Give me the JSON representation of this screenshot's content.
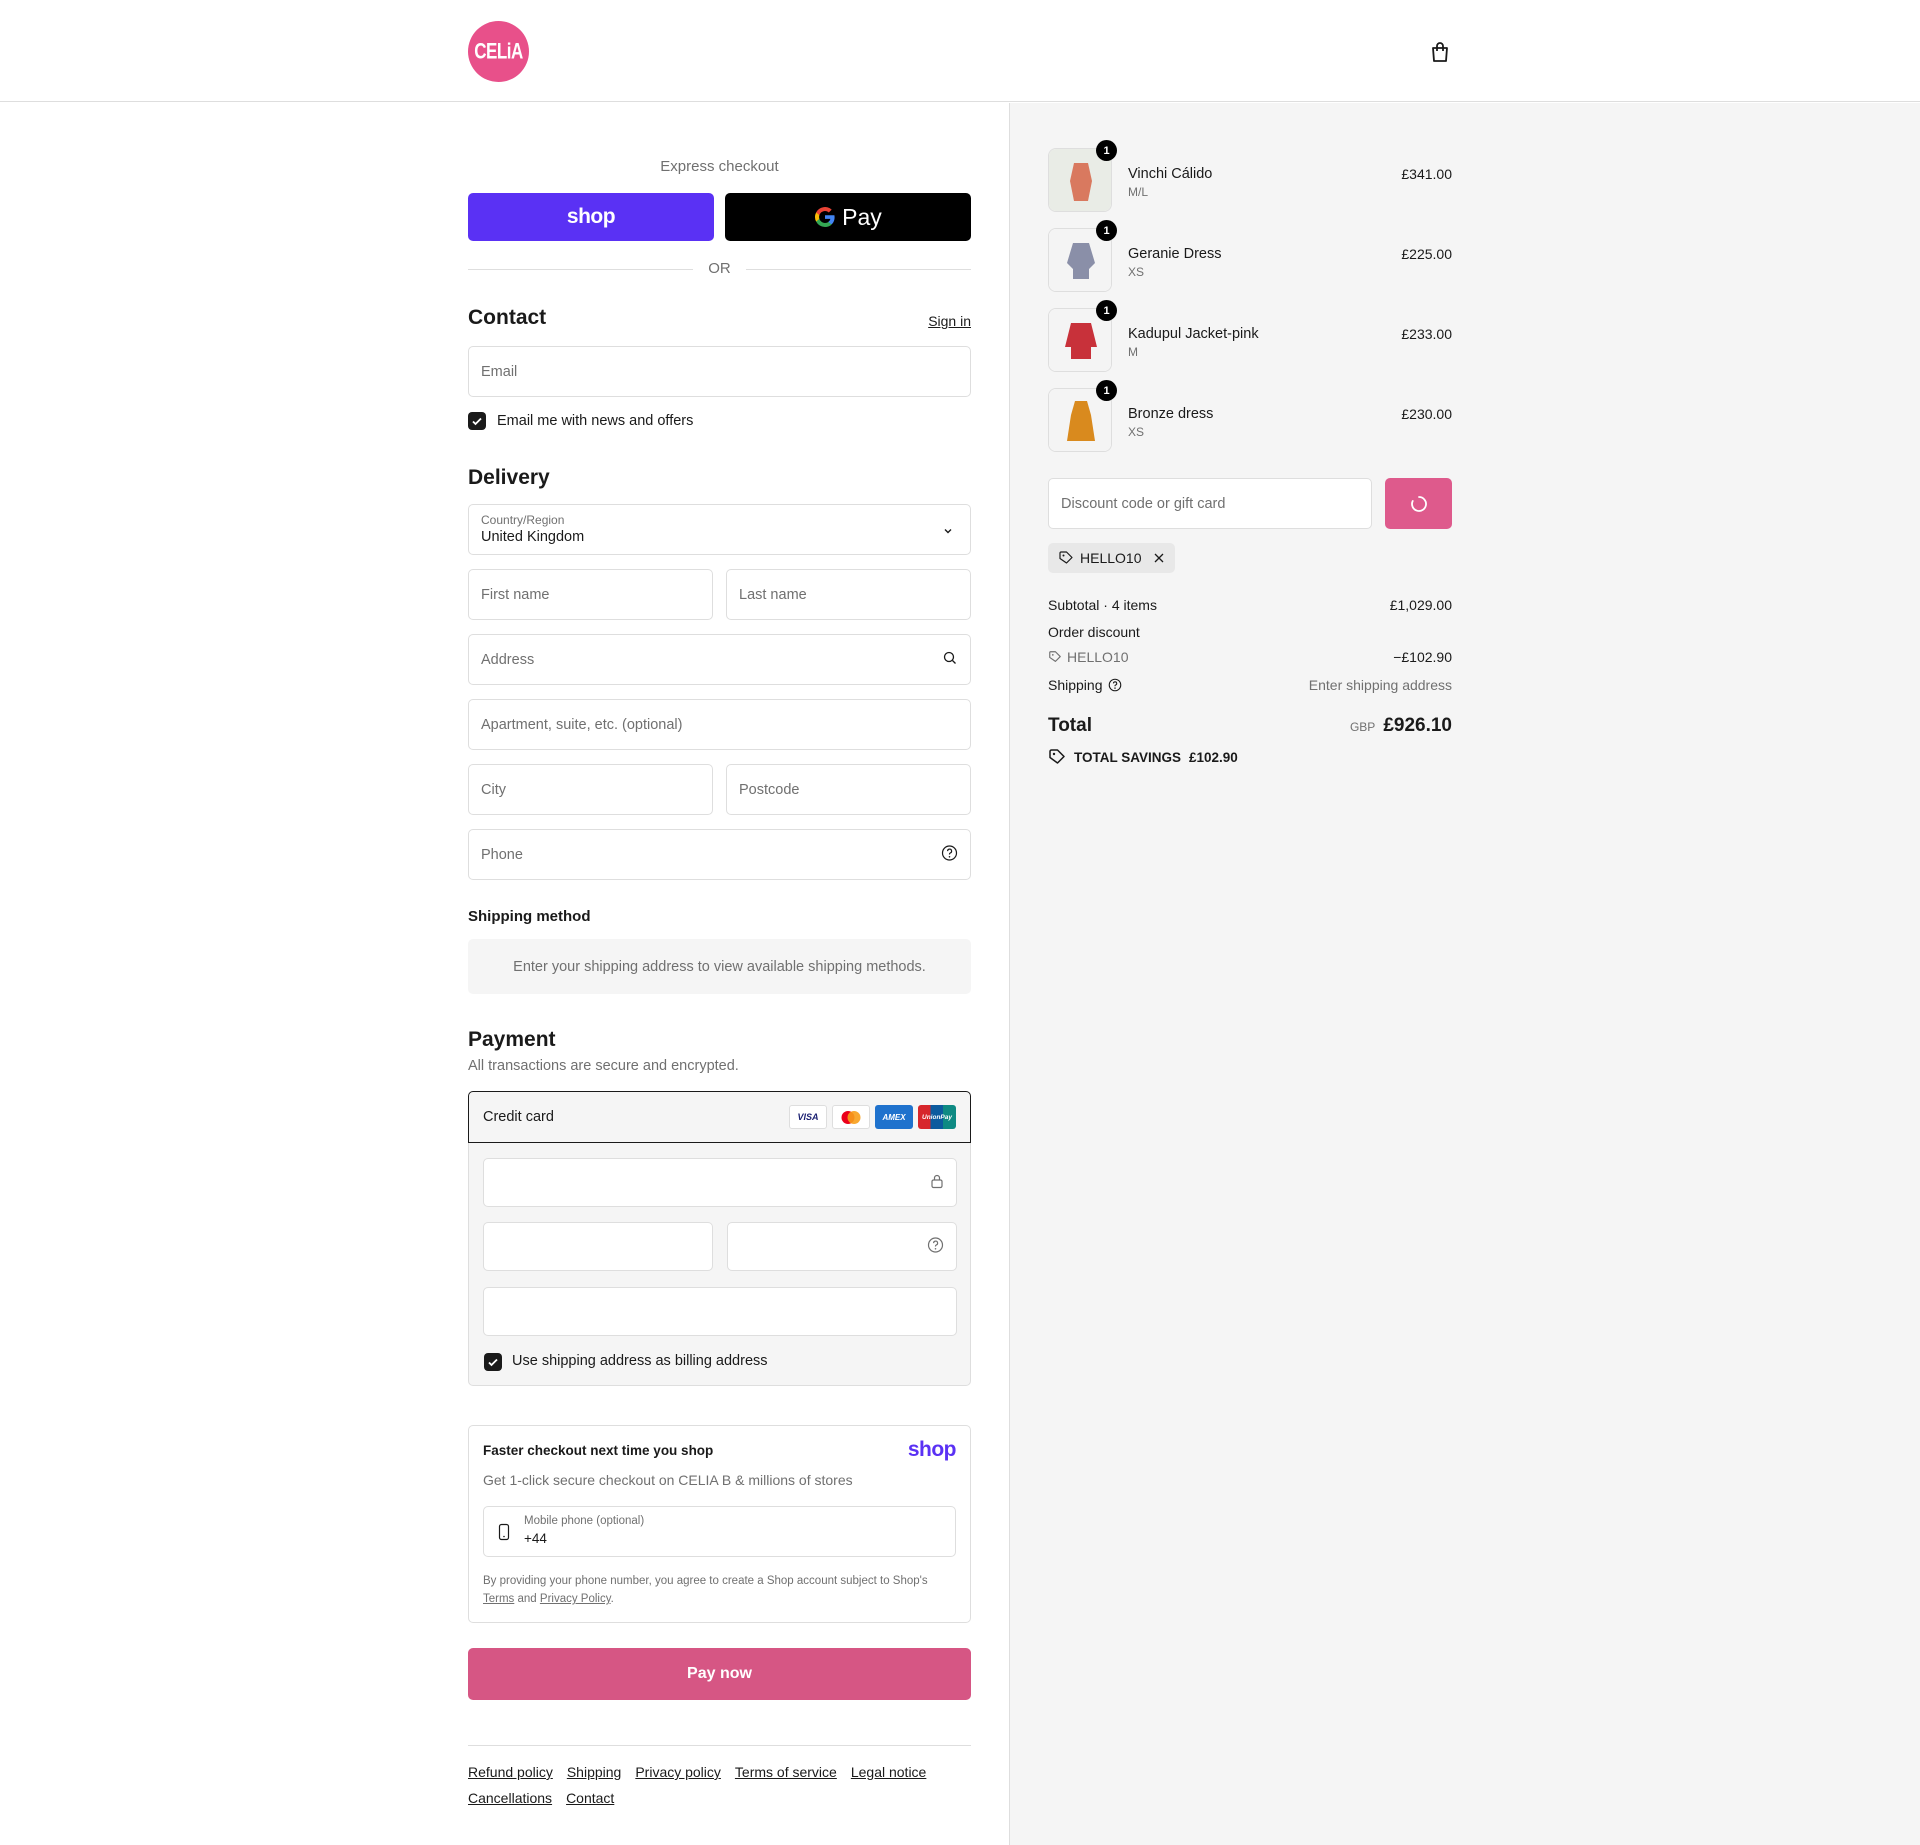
{
  "brand": {
    "logo_text": "CELiA",
    "accent": "#e8508a",
    "pay_button_color": "#d65684"
  },
  "header": {
    "cart_icon": "shopping-bag-icon"
  },
  "express": {
    "title": "Express checkout",
    "shop_label": "shop",
    "gpay_label": "Pay",
    "or_label": "OR"
  },
  "contact": {
    "heading": "Contact",
    "sign_in": "Sign in",
    "email_placeholder": "Email",
    "newsletter_label": "Email me with news and offers",
    "newsletter_checked": true
  },
  "delivery": {
    "heading": "Delivery",
    "country_label": "Country/Region",
    "country_value": "United Kingdom",
    "first_name": "First name",
    "last_name": "Last name",
    "address": "Address",
    "apartment": "Apartment, suite, etc. (optional)",
    "city": "City",
    "postcode": "Postcode",
    "phone": "Phone"
  },
  "shipping_method": {
    "heading": "Shipping method",
    "message": "Enter your shipping address to view available shipping methods."
  },
  "payment": {
    "heading": "Payment",
    "subtitle": "All transactions are secure and encrypted.",
    "method_label": "Credit card",
    "card_brands": [
      "VISA",
      "mastercard",
      "AMEX",
      "UnionPay"
    ],
    "billing_label": "Use shipping address as billing address",
    "billing_checked": true
  },
  "shop_pay": {
    "title": "Faster checkout next time you shop",
    "logo": "shop",
    "description": "Get 1-click secure checkout on CELIA B & millions of stores",
    "phone_label": "Mobile phone (optional)",
    "phone_value": "+44",
    "legal_prefix": "By providing your phone number, you agree to create a Shop account subject to Shop's",
    "terms": "Terms",
    "and": "and",
    "privacy": "Privacy Policy",
    "period": "."
  },
  "pay_now": "Pay now",
  "footer": {
    "links": [
      "Refund policy",
      "Shipping",
      "Privacy policy",
      "Terms of service",
      "Legal notice",
      "Cancellations",
      "Contact"
    ]
  },
  "cart": {
    "items": [
      {
        "name": "Vinchi Cálido",
        "variant": "M/L",
        "price": "£341.00",
        "qty": "1",
        "color": "#d9795f"
      },
      {
        "name": "Geranie Dress",
        "variant": "XS",
        "price": "£225.00",
        "qty": "1",
        "color": "#8a8fa8"
      },
      {
        "name": "Kadupul Jacket-pink",
        "variant": "M",
        "price": "£233.00",
        "qty": "1",
        "color": "#c8313a"
      },
      {
        "name": "Bronze dress",
        "variant": "XS",
        "price": "£230.00",
        "qty": "1",
        "color": "#d98a1e"
      }
    ],
    "discount_placeholder": "Discount code or gift card",
    "applied_code": "HELLO10",
    "subtotal_label": "Subtotal · 4 items",
    "subtotal_value": "£1,029.00",
    "order_discount_label": "Order discount",
    "discount_code": "HELLO10",
    "discount_value": "−£102.90",
    "shipping_label": "Shipping",
    "shipping_value": "Enter shipping address",
    "total_label": "Total",
    "currency": "GBP",
    "total_value": "£926.10",
    "savings_label": "TOTAL SAVINGS",
    "savings_value": "£102.90"
  }
}
